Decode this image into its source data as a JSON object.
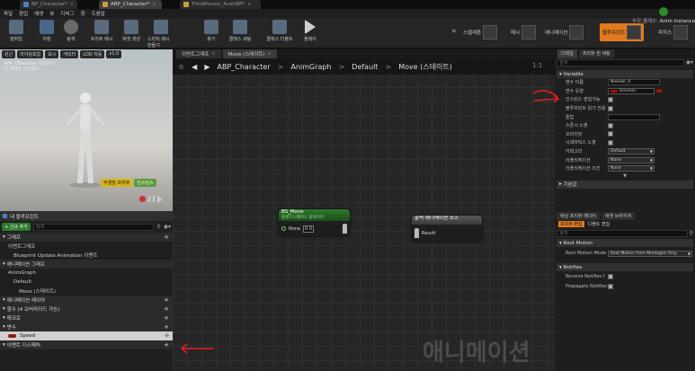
{
  "doc_tabs": [
    "BP_Character*",
    "ABP_Character*",
    "ThirdPerson_AnimBP*"
  ],
  "menu": [
    "파일",
    "편집",
    "애셋",
    "뷰",
    "디버그",
    "창",
    "도움말"
  ],
  "toolbar": [
    {
      "label": "컴파일",
      "icon": "compile-icon"
    },
    {
      "label": "저장",
      "icon": "save-icon"
    },
    {
      "label": "탐색",
      "icon": "find-in-cb-icon"
    },
    {
      "label": "프리뷰 메시",
      "icon": "preview-mesh-icon"
    },
    {
      "label": "애셋 생성",
      "icon": "create-asset-icon"
    },
    {
      "label": "스타틱 메시 만들기",
      "icon": "static-mesh-icon"
    },
    {
      "label": "찾기",
      "icon": "find-icon"
    },
    {
      "label": "클래스 세팅",
      "icon": "class-settings-icon"
    },
    {
      "label": "클래스 디폴트",
      "icon": "class-defaults-icon"
    },
    {
      "label": "플레이",
      "icon": "play-icon"
    }
  ],
  "toolbar_extra": [
    "관련 에셋 숨김"
  ],
  "modes": [
    {
      "label": "스켈레톤",
      "active": false
    },
    {
      "label": "메시",
      "active": false
    },
    {
      "label": "애니메이션",
      "active": false
    },
    {
      "label": "블루프린트",
      "active": true
    },
    {
      "label": "피직스",
      "active": false
    }
  ],
  "anim_instance": {
    "parent": "부모 클래스:",
    "name": "Anim Instance"
  },
  "viewport": {
    "buttons": [
      "원근",
      "라이팅포함",
      "표시",
      "캐릭터",
      "LOD 자동",
      "x1.0"
    ],
    "info": [
      "ABP_Character 미리보기",
      "비 프리뷰 인스턴스"
    ],
    "mode_buttons": [
      "무결점 프리뷰",
      "인스턴스"
    ]
  },
  "my_blueprint": {
    "tab": "내 블루프린트",
    "add_label": "+ 신규 추가",
    "search_placeholder": "검색",
    "rows": [
      {
        "label": "그래프",
        "type": "sec",
        "plus": true
      },
      {
        "label": "이벤트그래프",
        "type": "item",
        "indent": 1
      },
      {
        "label": "Blueprint Update Animation 이벤트",
        "type": "item",
        "indent": 2
      },
      {
        "label": "애니메이션 그래프",
        "type": "sec",
        "plus": false
      },
      {
        "label": "AnimGraph",
        "type": "item",
        "indent": 1
      },
      {
        "label": "Default",
        "type": "item",
        "indent": 2
      },
      {
        "label": "Move (스테이트)",
        "type": "item",
        "indent": 3
      },
      {
        "label": "애니메이션 레이어",
        "type": "sec",
        "plus": true
      },
      {
        "label": "함수 (4 오버라이드 가능)",
        "type": "sec",
        "plus": true
      },
      {
        "label": "매크로",
        "type": "sec",
        "plus": true
      },
      {
        "label": "변수",
        "type": "sec",
        "plus": true
      },
      {
        "label": "Speed",
        "type": "var",
        "indent": 1
      },
      {
        "label": "이벤트 디스패처",
        "type": "sec",
        "plus": true
      }
    ]
  },
  "graph_tabs": [
    {
      "label": "이벤트그래프",
      "active": false
    },
    {
      "label": "Move (스테이트)",
      "active": true
    }
  ],
  "breadcrumb": [
    "ABP_Character",
    "AnimGraph",
    "Default",
    "Move (스테이트)"
  ],
  "zoom": "1:1",
  "nodes": {
    "bs": {
      "title": "BS_Move",
      "subtitle": "블렌드스페이스 플레이어",
      "pin": "None",
      "value": "0.0"
    },
    "out": {
      "title": "출력 애니메이션 포즈",
      "pin": "Result"
    }
  },
  "watermark": "애니메이션",
  "details": {
    "tabs": [
      "디테일",
      "프리뷰 씬 세팅"
    ],
    "search_placeholder": "검색",
    "variable_section": "Variable",
    "props": [
      {
        "label": "변수 이름",
        "kind": "text",
        "value": "NewVar_0"
      },
      {
        "label": "변수 유형",
        "kind": "type",
        "value": "Boolean"
      },
      {
        "label": "인스턴스 편집가능",
        "kind": "check"
      },
      {
        "label": "블루프린트 읽기 전용",
        "kind": "check"
      },
      {
        "label": "툴팁",
        "kind": "text",
        "value": ""
      },
      {
        "label": "스폰시 노출",
        "kind": "check"
      },
      {
        "label": "프라이빗",
        "kind": "check"
      },
      {
        "label": "시네마틱스 노출",
        "kind": "check"
      },
      {
        "label": "카테고리",
        "kind": "dd",
        "value": "Default"
      },
      {
        "label": "리플리케이션",
        "kind": "dd",
        "value": "None"
      },
      {
        "label": "리플리케이션 조건",
        "kind": "dd",
        "value": "None"
      }
    ],
    "default_section": "기본값",
    "lower_tabs": [
      "애님 프리뷰 에디터",
      "애셋 브라우저"
    ],
    "lower_subtabs": [
      "프리뷰 편집",
      "디폴트 편집"
    ],
    "lower_search_placeholder": "검색",
    "root_motion_section": "Root Motion",
    "root_motion_label": "Root Motion Mode",
    "root_motion_value": "Root Motion from Montages Only",
    "notifies_section": "Notifies",
    "notify_rows": [
      "Receive Notifies f",
      "Propagate Notifies"
    ]
  }
}
